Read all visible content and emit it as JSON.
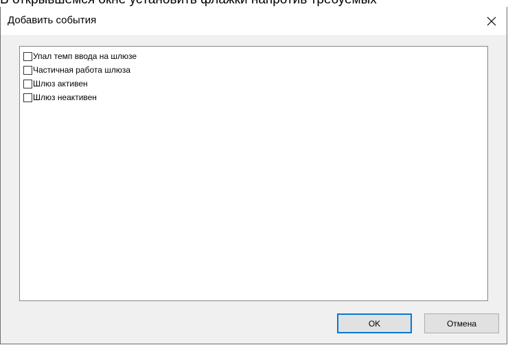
{
  "background_caption": "В открывшемся окне установить флажки напротив требуемых",
  "dialog": {
    "title": "Добавить события",
    "close_icon": "close-icon"
  },
  "events": [
    {
      "label": "Упал темп ввода на шлюзе",
      "checked": false
    },
    {
      "label": "Частичная работа шлюза",
      "checked": false
    },
    {
      "label": "Шлюз активен",
      "checked": false
    },
    {
      "label": "Шлюз неактивен",
      "checked": false
    }
  ],
  "buttons": {
    "ok_label": "OK",
    "cancel_label": "Отмена"
  }
}
